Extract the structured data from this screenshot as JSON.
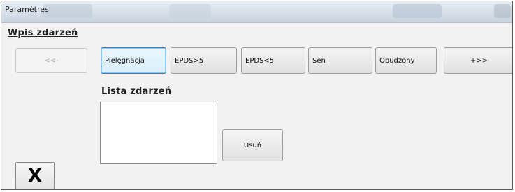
{
  "window": {
    "title": "Paramètres"
  },
  "events_section": {
    "title": "Wpis zdarzeń",
    "prev_label": "<<-",
    "next_label": "+>>",
    "event_buttons": [
      "Pielęgnacja",
      "EPDS>5",
      "EPDS<5",
      "Sen",
      "Obudzony"
    ]
  },
  "list_section": {
    "title": "Lista zdarzeń",
    "delete_label": "Usuń"
  },
  "close": {
    "label": "X"
  },
  "colors": {
    "focus_border": "#3c7fb1",
    "window_bg": "#f2f2f2"
  }
}
